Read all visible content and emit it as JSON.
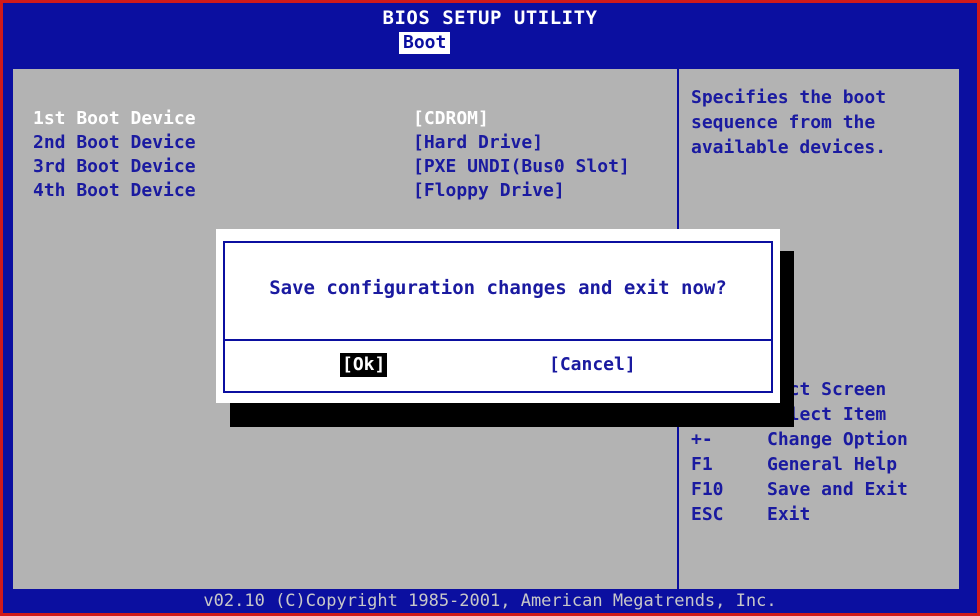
{
  "header": {
    "title": "BIOS SETUP UTILITY",
    "active_tab": "Boot"
  },
  "boot_devices": [
    {
      "label": "1st Boot Device",
      "value": "[CDROM]"
    },
    {
      "label": "2nd Boot Device",
      "value": "[Hard Drive]"
    },
    {
      "label": "3rd Boot Device",
      "value": "[PXE UNDI(Bus0 Slot]"
    },
    {
      "label": "4th Boot Device",
      "value": "[Floppy Drive]"
    }
  ],
  "help": {
    "text": "Specifies the boot sequence from the available devices."
  },
  "keys": [
    {
      "key": "",
      "desc": "lect Screen"
    },
    {
      "key": "↑↓",
      "desc": "Select Item"
    },
    {
      "key": "+-",
      "desc": "Change Option"
    },
    {
      "key": "F1",
      "desc": "General Help"
    },
    {
      "key": "F10",
      "desc": "Save and Exit"
    },
    {
      "key": "ESC",
      "desc": "Exit"
    }
  ],
  "dialog": {
    "message": "Save configuration changes and exit now?",
    "ok_label": "[Ok]",
    "cancel_label": "[Cancel]"
  },
  "footer": {
    "copyright": "v02.10 (C)Copyright 1985-2001, American Megatrends, Inc."
  }
}
